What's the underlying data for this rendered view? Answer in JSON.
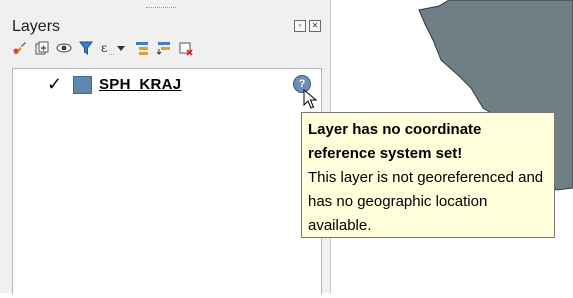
{
  "panel": {
    "title": "Layers",
    "dock_buttons": [
      "float-icon",
      "close-icon"
    ]
  },
  "toolbar": {
    "icons": [
      "open-layer-styling-icon",
      "add-group-icon",
      "manage-map-themes-icon",
      "filter-legend-icon",
      "filter-by-expression-icon",
      "dropdown-arrow-icon",
      "expand-all-icon",
      "collapse-all-icon",
      "remove-layer-icon"
    ]
  },
  "layers": [
    {
      "name": "SPH_KRAJ",
      "checked": true,
      "swatch_color": "#5c88ad",
      "warning_icon": "crs-warning-icon"
    }
  ],
  "tooltip": {
    "title": "Layer has no coordinate reference system set!",
    "body": "This layer is not georeferenced and has no geographic location available."
  },
  "colors": {
    "map_feature": "#6e7f86",
    "tooltip_bg": "#ffffdc"
  }
}
